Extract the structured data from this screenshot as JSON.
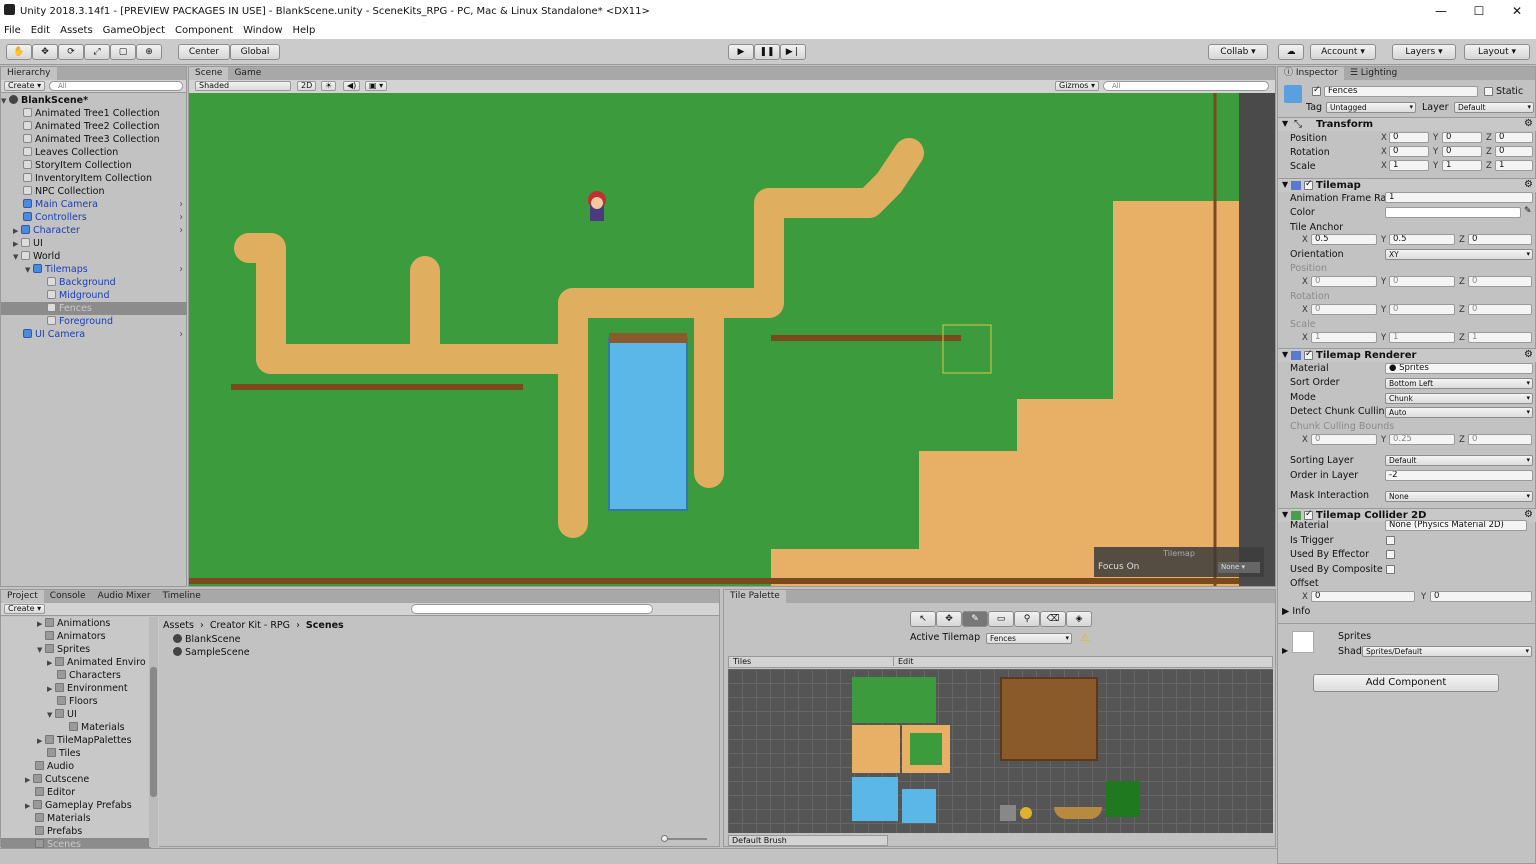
{
  "window": {
    "title": "Unity 2018.3.14f1 - [PREVIEW PACKAGES IN USE] - BlankScene.unity - SceneKits_RPG - PC, Mac & Linux Standalone* <DX11>"
  },
  "menu": [
    "File",
    "Edit",
    "Assets",
    "GameObject",
    "Component",
    "Window",
    "Help"
  ],
  "toolbar": {
    "center": "Center",
    "global": "Global",
    "collab": "Collab",
    "account": "Account",
    "layers": "Layers",
    "layout": "Layout"
  },
  "hierarchy": {
    "tab": "Hierarchy",
    "create": "Create",
    "search": "All",
    "scene": "BlankScene*",
    "items": [
      "Animated Tree1 Collection",
      "Animated Tree2 Collection",
      "Animated Tree3 Collection",
      "Leaves Collection",
      "StoryItem Collection",
      "InventoryItem Collection",
      "NPC Collection",
      "Main Camera",
      "Controllers",
      "Character",
      "UI",
      "World",
      "Tilemaps",
      "Background",
      "Midground",
      "Fences",
      "Foreground",
      "UI Camera"
    ]
  },
  "scene": {
    "tab_scene": "Scene",
    "tab_game": "Game",
    "shaded": "Shaded",
    "mode2d": "2D",
    "gizmos": "Gizmos",
    "search": "All",
    "overlay_title": "Tilemap",
    "focus_label": "Focus On",
    "focus_value": "None"
  },
  "inspector": {
    "tab": "Inspector",
    "tab_lighting": "Lighting",
    "name": "Fences",
    "static": "Static",
    "tag_label": "Tag",
    "tag": "Untagged",
    "layer_label": "Layer",
    "layer": "Default",
    "transform": {
      "title": "Transform",
      "position": "Position",
      "rotation": "Rotation",
      "scale": "Scale",
      "px": "0",
      "py": "0",
      "pz": "0",
      "rx": "0",
      "ry": "0",
      "rz": "0",
      "sx": "1",
      "sy": "1",
      "sz": "1"
    },
    "tilemap": {
      "title": "Tilemap",
      "anim_label": "Animation Frame Rat",
      "anim": "1",
      "color": "Color",
      "anchor": "Tile Anchor",
      "ax": "0.5",
      "ay": "0.5",
      "az": "0",
      "orientation": "Orientation",
      "orient_val": "XY",
      "position": "Position",
      "rotation": "Rotation",
      "scale": "Scale",
      "zero": "0",
      "one": "1"
    },
    "renderer": {
      "title": "Tilemap Renderer",
      "material": "Material",
      "material_val": "Sprites",
      "sort": "Sort Order",
      "sort_val": "Bottom Left",
      "mode": "Mode",
      "mode_val": "Chunk",
      "detect": "Detect Chunk Culling",
      "detect_val": "Auto",
      "bounds": "Chunk Culling Bounds",
      "bx": "0",
      "by": "0.25",
      "bz": "0",
      "sorting": "Sorting Layer",
      "sorting_val": "Default",
      "order": "Order in Layer",
      "order_val": "-2",
      "mask": "Mask Interaction",
      "mask_val": "None"
    },
    "collider": {
      "title": "Tilemap Collider 2D",
      "material": "Material",
      "material_val": "None (Physics Material 2D)",
      "trigger": "Is Trigger",
      "effector": "Used By Effector",
      "composite": "Used By Composite",
      "offset": "Offset",
      "ox": "0",
      "oy": "0",
      "info": "Info"
    },
    "sprites": {
      "title": "Sprites",
      "shader": "Shader",
      "shader_val": "Sprites/Default"
    },
    "add": "Add Component"
  },
  "project": {
    "tabs": [
      "Project",
      "Console",
      "Audio Mixer",
      "Timeline"
    ],
    "create": "Create",
    "tree": [
      "Animations",
      "Animators",
      "Sprites",
      "Animated Enviro",
      "Characters",
      "Environment",
      "Floors",
      "UI",
      "Materials",
      "TileMapPalettes",
      "Tiles",
      "Audio",
      "Cutscene",
      "Editor",
      "Gameplay Prefabs",
      "Materials",
      "Prefabs",
      "Scenes"
    ],
    "breadcrumb": [
      "Assets",
      "Creator Kit - RPG",
      "Scenes"
    ],
    "files": [
      "BlankScene",
      "SampleScene"
    ]
  },
  "palette": {
    "tab": "Tile Palette",
    "active_label": "Active Tilemap",
    "active_val": "Fences",
    "tiles": "Tiles",
    "edit": "Edit",
    "brush": "Default Brush"
  }
}
